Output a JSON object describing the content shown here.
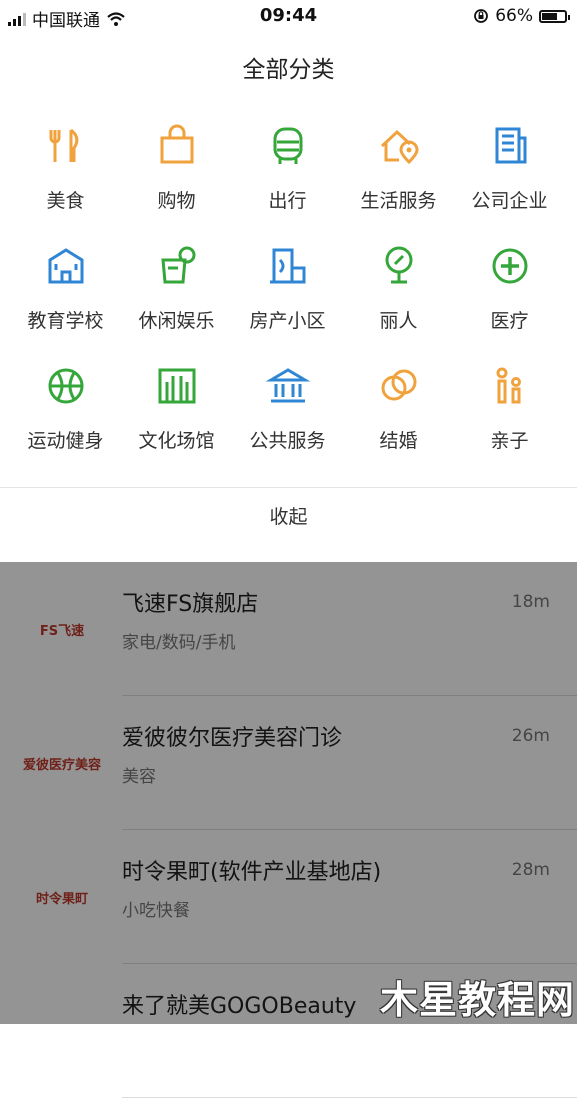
{
  "status_bar": {
    "carrier": "中国联通",
    "time": "09:44",
    "battery_percent": "66%",
    "battery_level": 0.66
  },
  "panel": {
    "title": "全部分类",
    "collapse_label": "收起",
    "categories": [
      {
        "label": "美食",
        "icon": "fork-knife-icon",
        "color": "#f0a23c"
      },
      {
        "label": "购物",
        "icon": "shopping-bag-icon",
        "color": "#f0a23c"
      },
      {
        "label": "出行",
        "icon": "bus-icon",
        "color": "#35a63a"
      },
      {
        "label": "生活服务",
        "icon": "house-location-icon",
        "color": "#f0a23c"
      },
      {
        "label": "公司企业",
        "icon": "office-building-icon",
        "color": "#2f86d4"
      },
      {
        "label": "教育学校",
        "icon": "school-building-icon",
        "color": "#2f86d4"
      },
      {
        "label": "休闲娱乐",
        "icon": "drink-cup-icon",
        "color": "#35a63a"
      },
      {
        "label": "房产小区",
        "icon": "residence-icon",
        "color": "#2f86d4"
      },
      {
        "label": "丽人",
        "icon": "mirror-icon",
        "color": "#35a63a"
      },
      {
        "label": "医疗",
        "icon": "medical-plus-icon",
        "color": "#35a63a"
      },
      {
        "label": "运动健身",
        "icon": "ball-icon",
        "color": "#35a63a"
      },
      {
        "label": "文化场馆",
        "icon": "cultural-venue-icon",
        "color": "#35a63a"
      },
      {
        "label": "公共服务",
        "icon": "government-building-icon",
        "color": "#2f86d4"
      },
      {
        "label": "结婚",
        "icon": "rings-icon",
        "color": "#f0a23c"
      },
      {
        "label": "亲子",
        "icon": "parent-child-icon",
        "color": "#f0a23c"
      }
    ]
  },
  "list": [
    {
      "name": "飞速FS旗舰店",
      "category": "家电/数码/手机",
      "distance": "18m",
      "logo_text": "FS飞速"
    },
    {
      "name": "爱彼彼尔医疗美容门诊",
      "category": "美容",
      "distance": "26m",
      "logo_text": "爱彼医疗美容"
    },
    {
      "name": "时令果町(软件产业基地店)",
      "category": "小吃快餐",
      "distance": "28m",
      "logo_text": "时令果町"
    },
    {
      "name": "来了就美GOGOBeauty",
      "category": "",
      "distance": "",
      "logo_text": ""
    }
  ],
  "watermark": "木星教程网"
}
